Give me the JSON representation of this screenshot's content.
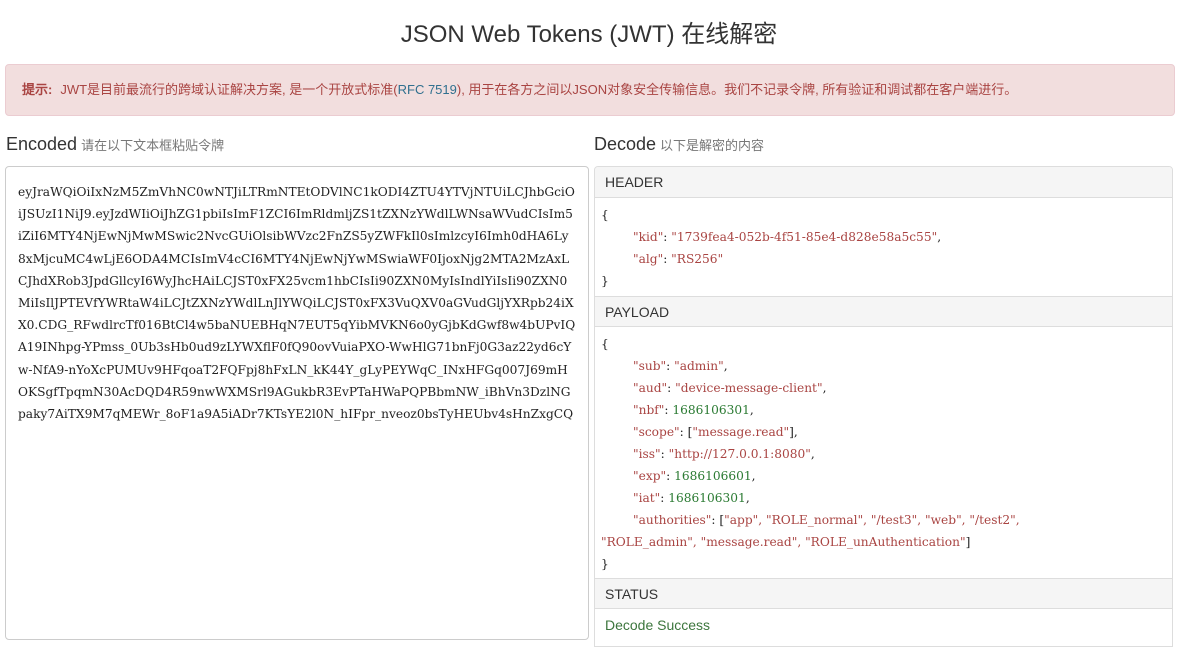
{
  "page": {
    "title": "JSON Web Tokens (JWT) 在线解密"
  },
  "alert": {
    "label": "提示:",
    "text_before": "JWT是目前最流行的跨域认证解决方案, 是一个开放式标准(",
    "link": "RFC 7519",
    "text_after": "), 用于在各方之间以JSON对象安全传输信息。我们不记录令牌, 所有验证和调试都在客户端进行。"
  },
  "encoded": {
    "heading": "Encoded",
    "subheading": "请在以下文本框粘贴令牌",
    "token": "eyJraWQiOiIxNzM5ZmVhNC0wNTJiLTRmNTEtODVlNC1kODI4ZTU4YTVjNTUiLCJhbGciOiJSUzI1NiJ9.eyJzdWIiOiJhZG1pbiIsImF1ZCI6ImRldmljZS1tZXNzYWdlLWNsaWVudCIsIm5iZiI6MTY4NjEwNjMwMSwic2NvcGUiOlsibWVzc2FnZS5yZWFkIl0sImlzcyI6Imh0dHA6Ly8xMjcuMC4wLjE6ODA4MCIsImV4cCI6MTY4NjEwNjYwMSwiaWF0IjoxNjg2MTA2MzAxLCJhdXRob3JpdGllcyI6WyJhcHAiLCJST0xFX25vcm1hbCIsIi90ZXN0MyIsIndlYiIsIi90ZXN0MiIsIlJPTEVfYWRtaW4iLCJtZXNzYWdlLnJlYWQiLCJST0xFX3VuQXV0aGVudGljYXRpb24iXX0.CDG_RFwdlrcTf016BtCl4w5baNUEBHqN7EUT5qYibMVKN6o0yGjbKdGwf8w4bUPvIQA19INhpg-YPmss_0Ub3sHb0ud9zLYWXflF0fQ90ovVuiaPXO-WwHlG71bnFj0G3az22yd6cYw-NfA9-nYoXcPUMUv9HFqoaT2FQFpj8hFxLN_kK44Y_gLyPEYWqC_INxHFGq007J69mHOKSgfTpqmN30AcDQD4R59nwWXMSrl9AGukbR3EvPTaHWaPQPBbmNW_iBhVn3DzlNGpaky7AiTX9M7qMEWr_8oF1a9A5iADr7KTsYE2l0N_hIFpr_nveoz0bsTyHEUbv4sHnZxgCQ"
  },
  "decode": {
    "heading": "Decode",
    "subheading": "以下是解密的内容",
    "header_title": "HEADER",
    "payload_title": "PAYLOAD",
    "status_title": "STATUS",
    "open_brace": "{",
    "close_brace": "}",
    "header": {
      "kid_key": "\"kid\"",
      "kid_val": "\"1739fea4-052b-4f51-85e4-d828e58a5c55\"",
      "alg_key": "\"alg\"",
      "alg_val": "\"RS256\""
    },
    "payload": {
      "sub_key": "\"sub\"",
      "sub_val": "\"admin\"",
      "aud_key": "\"aud\"",
      "aud_val": "\"device-message-client\"",
      "nbf_key": "\"nbf\"",
      "nbf_val": "1686106301",
      "scope_key": "\"scope\"",
      "scope_val": "\"message.read\"",
      "iss_key": "\"iss\"",
      "iss_val": "\"http://127.0.0.1:8080\"",
      "exp_key": "\"exp\"",
      "exp_val": "1686106601",
      "iat_key": "\"iat\"",
      "iat_val": "1686106301",
      "authorities_key": "\"authorities\"",
      "auth_line1": "\"app\", \"ROLE_normal\", \"/test3\", \"web\", \"/test2\",",
      "auth_line2": "\"ROLE_admin\", \"message.read\", \"ROLE_unAuthentication\""
    },
    "status_text": "Decode Success"
  },
  "colors": {
    "alert_bg": "#f2dede",
    "alert_text": "#a94442",
    "link": "#31708f",
    "number": "#2a7a32",
    "success": "#3c763d"
  }
}
